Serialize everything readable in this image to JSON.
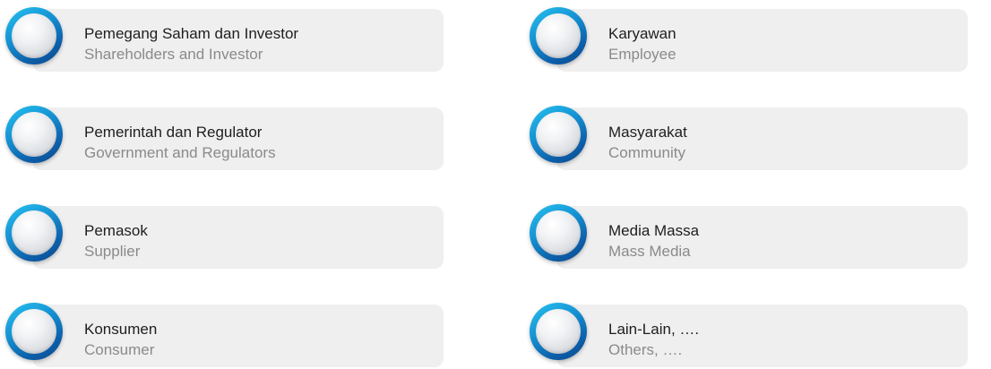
{
  "stakeholders": [
    {
      "title": "Pemegang Saham dan Investor",
      "subtitle": "Shareholders and Investor"
    },
    {
      "title": "Pemerintah dan Regulator",
      "subtitle": "Government and Regulators"
    },
    {
      "title": "Pemasok",
      "subtitle": "Supplier"
    },
    {
      "title": "Konsumen",
      "subtitle": "Consumer"
    },
    {
      "title": "Karyawan",
      "subtitle": "Employee"
    },
    {
      "title": "Masyarakat",
      "subtitle": "Community"
    },
    {
      "title": "Media Massa",
      "subtitle": "Mass Media"
    },
    {
      "title": "Lain-Lain, ….",
      "subtitle": "Others, …."
    }
  ],
  "colors": {
    "ring_light": "#27c3f0",
    "ring_dark": "#0b4b8f",
    "card_bg": "#efefef",
    "title_text": "#1e1e1e",
    "subtitle_text": "#8a8a8a"
  }
}
